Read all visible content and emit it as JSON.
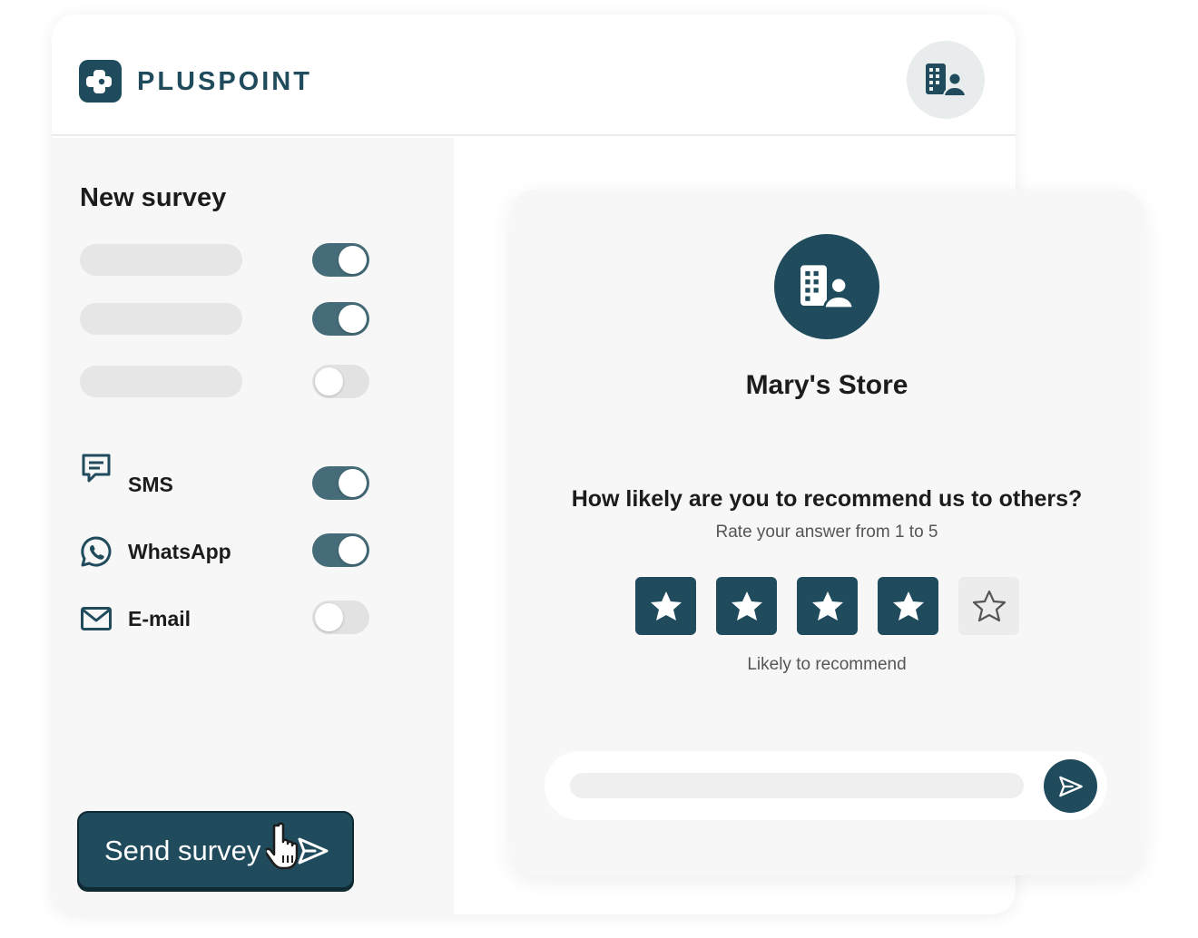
{
  "app": {
    "brand": "PLUSPOINT",
    "logo_icon": "plus-logo-icon",
    "avatar_icon": "business-user-icon"
  },
  "colors": {
    "brand": "#1f4b5c",
    "toggle_on": "#456c78",
    "toggle_off": "#e2e2e2",
    "panel_bg": "#f7f7f7"
  },
  "sidebar": {
    "title": "New survey",
    "option_rows": [
      {
        "enabled": true
      },
      {
        "enabled": true
      },
      {
        "enabled": false
      }
    ],
    "channels": [
      {
        "label": "SMS",
        "icon": "message-icon",
        "enabled": true
      },
      {
        "label": "WhatsApp",
        "icon": "whatsapp-icon",
        "enabled": true
      },
      {
        "label": "E-mail",
        "icon": "mail-icon",
        "enabled": false
      }
    ],
    "send_button": {
      "label": "Send survey",
      "icon": "send-icon"
    }
  },
  "preview": {
    "store_icon": "business-user-icon",
    "store_name": "Mary's Store",
    "question": "How likely are you to recommend us to others?",
    "instruction": "Rate your answer from 1 to 5",
    "rating": {
      "value": 4,
      "max": 5
    },
    "rating_label": "Likely to recommend",
    "reply": {
      "value": "",
      "send_icon": "send-icon"
    }
  }
}
